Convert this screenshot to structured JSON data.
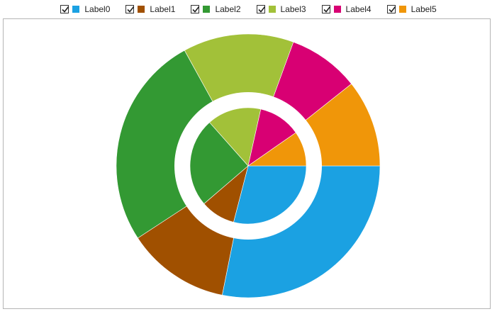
{
  "chart_data": {
    "type": "pie",
    "subtype": "nested-donut",
    "legend": {
      "placement": "top",
      "items": [
        {
          "label": "Label0",
          "color": "#1BA1E2",
          "checked": true
        },
        {
          "label": "Label1",
          "color": "#A05000",
          "checked": true
        },
        {
          "label": "Label2",
          "color": "#339933",
          "checked": true
        },
        {
          "label": "Label3",
          "color": "#A2C139",
          "checked": true
        },
        {
          "label": "Label4",
          "color": "#D80073",
          "checked": true
        },
        {
          "label": "Label5",
          "color": "#F09609",
          "checked": true
        }
      ]
    },
    "categories": [
      "Label0",
      "Label1",
      "Label2",
      "Label3",
      "Label4",
      "Label5"
    ],
    "series": [
      {
        "ring": "outer",
        "values": [
          29,
          13,
          27,
          14,
          9,
          11
        ]
      },
      {
        "ring": "inner",
        "values": [
          27,
          9,
          23,
          14,
          11,
          9
        ]
      }
    ]
  }
}
